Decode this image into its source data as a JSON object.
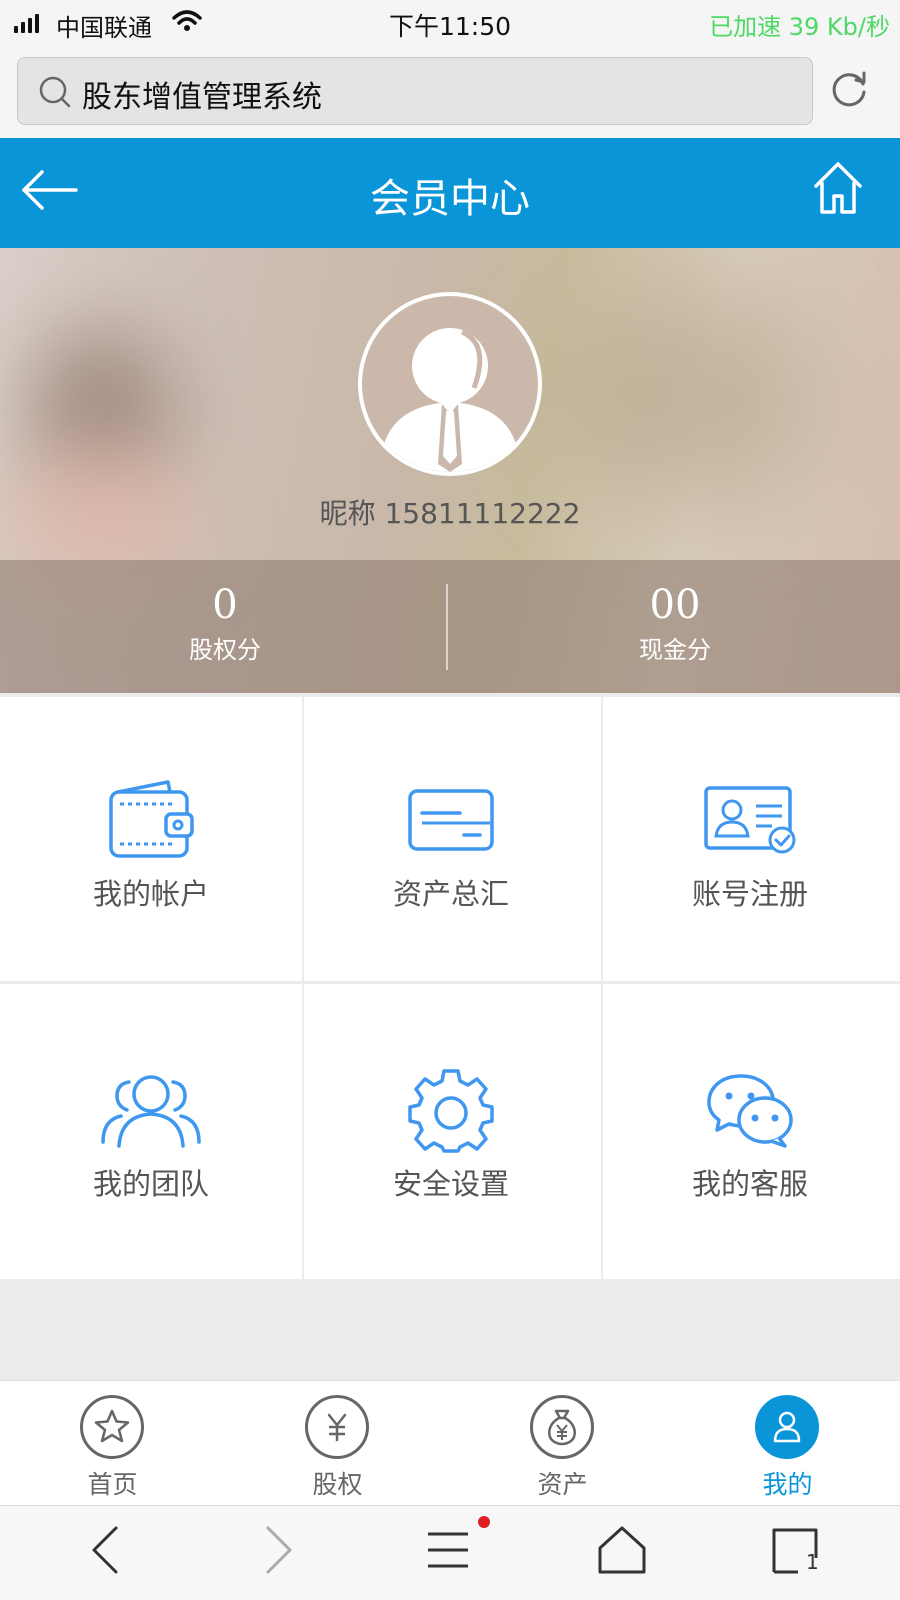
{
  "status_bar": {
    "carrier": "中国联通",
    "time": "下午11:50",
    "speed": "已加速 39 Kb/秒",
    "speed_color": "#4cd964",
    "icons": [
      "signal-icon",
      "wifi-icon"
    ]
  },
  "browser": {
    "address": "股东增值管理系统",
    "icons": [
      "search-icon",
      "reload-icon"
    ]
  },
  "header": {
    "title": "会员中心",
    "background_color": "#0a95d9",
    "icons": [
      "back-arrow-icon",
      "home-icon"
    ]
  },
  "profile": {
    "nickname": "昵称 15811112222",
    "avatar_icon": "user-avatar-icon",
    "stats": [
      {
        "value": "0",
        "label": "股权分"
      },
      {
        "value": "00",
        "label": "现金分"
      }
    ]
  },
  "menu": {
    "icon_color": "#3f97f0",
    "items": [
      {
        "label": "我的帐户",
        "icon": "wallet-icon"
      },
      {
        "label": "资产总汇",
        "icon": "card-icon"
      },
      {
        "label": "账号注册",
        "icon": "id-card-icon"
      },
      {
        "label": "我的团队",
        "icon": "team-icon"
      },
      {
        "label": "安全设置",
        "icon": "gear-icon"
      },
      {
        "label": "我的客服",
        "icon": "chat-icon"
      }
    ]
  },
  "tabbar": {
    "active_color": "#0a95d9",
    "items": [
      {
        "label": "首页",
        "icon": "star-icon",
        "active": false
      },
      {
        "label": "股权",
        "icon": "yen-icon",
        "active": false
      },
      {
        "label": "资产",
        "icon": "money-bag-icon",
        "active": false
      },
      {
        "label": "我的",
        "icon": "person-icon",
        "active": true
      }
    ]
  },
  "browser_toolbar": {
    "tab_count": "1",
    "icons": [
      "back-icon",
      "forward-icon",
      "menu-icon",
      "home-icon",
      "tabs-icon"
    ]
  }
}
